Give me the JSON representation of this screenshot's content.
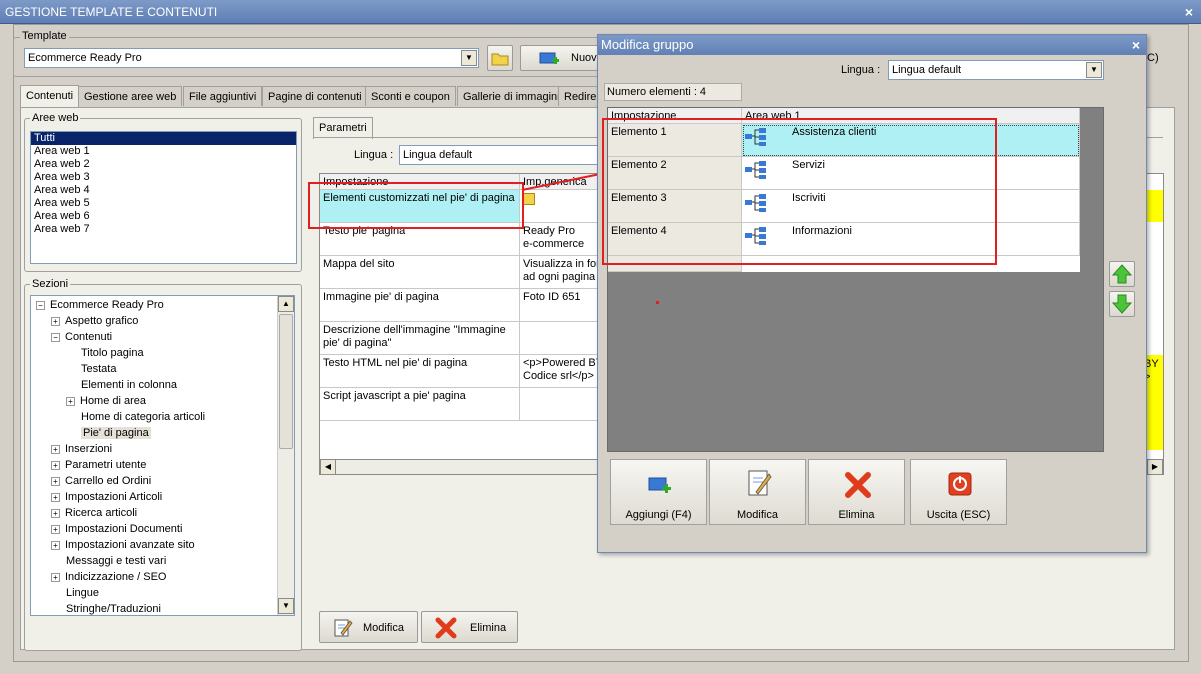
{
  "window": {
    "title": "GESTIONE TEMPLATE E CONTENUTI",
    "close": "×"
  },
  "template": {
    "group_label": "Template",
    "selected": "Ecommerce Ready Pro",
    "new_button_label": "Nuovo",
    "exit_fragment": "C)"
  },
  "tabs": [
    "Contenuti",
    "Gestione aree web",
    "File aggiuntivi",
    "Pagine di contenuti",
    "Sconti e coupon",
    "Gallerie di immagini",
    "Redire"
  ],
  "aree_web": {
    "label": "Aree web",
    "items": [
      "Tutti",
      "Area web 1",
      "Area web 2",
      "Area web 3",
      "Area web 4",
      "Area web 5",
      "Area web 6",
      "Area web 7"
    ],
    "selected": "Tutti"
  },
  "sezioni": {
    "label": "Sezioni",
    "items": [
      {
        "label": "Ecommerce Ready Pro",
        "expander": "−",
        "level": 0
      },
      {
        "label": "Aspetto grafico",
        "expander": "+",
        "level": 1
      },
      {
        "label": "Contenuti",
        "expander": "−",
        "level": 1
      },
      {
        "label": "Titolo pagina",
        "expander": "",
        "level": 2
      },
      {
        "label": "Testata",
        "expander": "",
        "level": 2
      },
      {
        "label": "Elementi in colonna",
        "expander": "",
        "level": 2
      },
      {
        "label": "Home di area",
        "expander": "+",
        "level": 2
      },
      {
        "label": "Home di categoria articoli",
        "expander": "",
        "level": 2
      },
      {
        "label": "Pie' di pagina",
        "expander": "",
        "level": 2,
        "selected": true
      },
      {
        "label": "Inserzioni",
        "expander": "+",
        "level": 1
      },
      {
        "label": "Parametri utente",
        "expander": "+",
        "level": 1
      },
      {
        "label": "Carrello ed Ordini",
        "expander": "+",
        "level": 1
      },
      {
        "label": "Impostazioni Articoli",
        "expander": "+",
        "level": 1
      },
      {
        "label": "Ricerca articoli",
        "expander": "+",
        "level": 1
      },
      {
        "label": "Impostazioni Documenti",
        "expander": "+",
        "level": 1
      },
      {
        "label": "Impostazioni avanzate sito",
        "expander": "+",
        "level": 1
      },
      {
        "label": "Messaggi e testi vari",
        "expander": "",
        "level": 1
      },
      {
        "label": "Indicizzazione / SEO",
        "expander": "+",
        "level": 1
      },
      {
        "label": "Lingue",
        "expander": "",
        "level": 1
      },
      {
        "label": "Stringhe/Traduzioni",
        "expander": "",
        "level": 1
      }
    ]
  },
  "parametri": {
    "tab_label": "Parametri",
    "lingua_label": "Lingua :",
    "lingua_value": "Lingua default",
    "headers": [
      "Impostazione",
      "Imp.generica"
    ],
    "rows": [
      {
        "name": "Elementi customizzati nel pie' di pagina",
        "value": ""
      },
      {
        "name": "Testo pie' pagina",
        "value": "Ready Pro\ne-commerce"
      },
      {
        "name": "Mappa del sito",
        "value": "Visualizza in fon\nad ogni pagina"
      },
      {
        "name": "Immagine pie' di pagina",
        "value": "Foto ID 651"
      },
      {
        "name": "Descrizione dell'immagine \"Immagine pie' di pagina\"",
        "value": ""
      },
      {
        "name": "Testo HTML nel pie' di pagina",
        "value": "<p>Powered BY\nCodice srl</p>"
      },
      {
        "name": "Script javascript a pie' pagina",
        "value": ""
      }
    ],
    "right_fragments": [
      "BY",
      ">"
    ],
    "modifica_label": "Modifica",
    "elimina_label": "Elimina"
  },
  "modal": {
    "title": "Modifica gruppo",
    "close": "×",
    "lingua_label": "Lingua :",
    "lingua_value": "Lingua default",
    "count_label": "Numero elementi : 4",
    "headers": [
      "Impostazione",
      "Area web 1"
    ],
    "rows": [
      {
        "name": "Elemento 1",
        "value": "Assistenza clienti"
      },
      {
        "name": "Elemento 2",
        "value": "Servizi"
      },
      {
        "name": "Elemento 3",
        "value": "Iscriviti"
      },
      {
        "name": "Elemento 4",
        "value": "Informazioni"
      }
    ],
    "buttons": {
      "aggiungi": "Aggiungi (F4)",
      "modifica": "Modifica",
      "elimina": "Elimina",
      "uscita": "Uscita (ESC)"
    }
  }
}
